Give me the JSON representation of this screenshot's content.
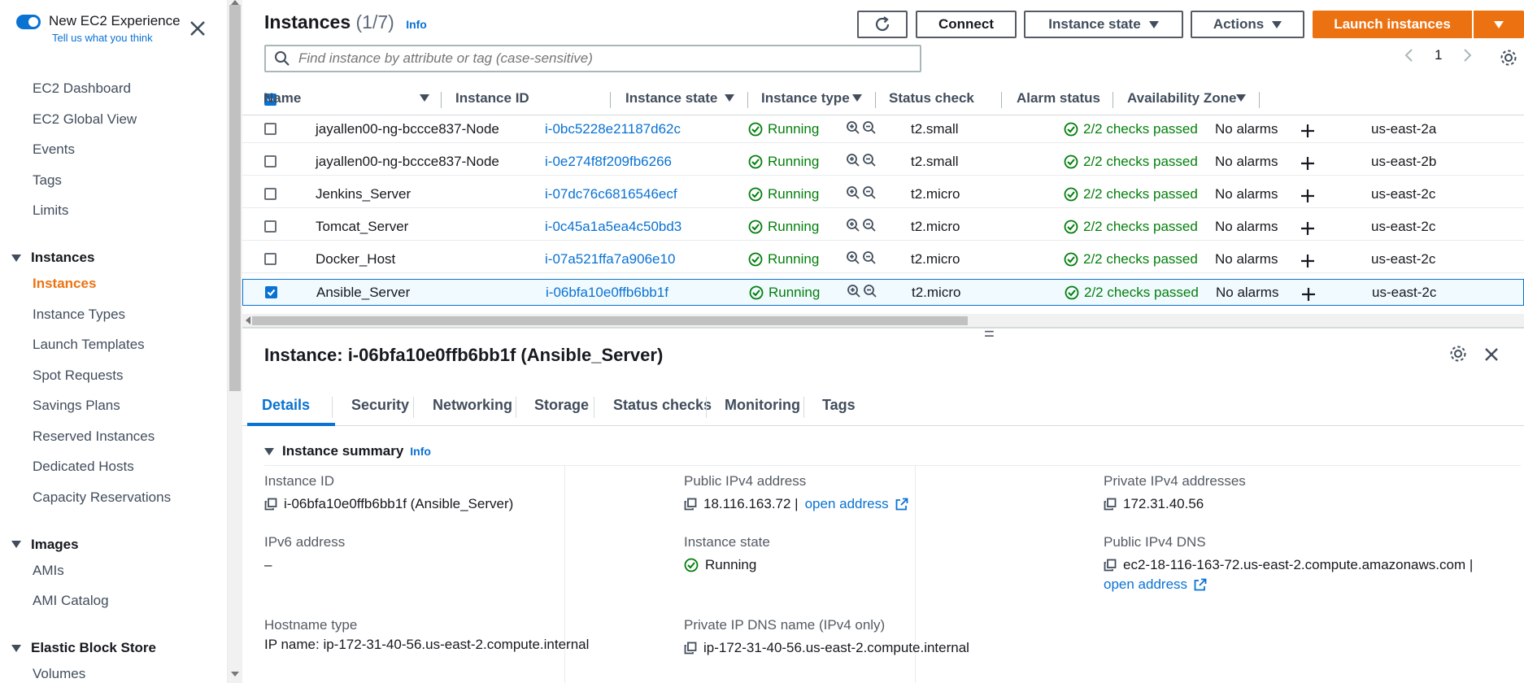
{
  "sidebar": {
    "toggle_title": "New EC2 Experience",
    "toggle_sub": "Tell us what you think",
    "top_items": [
      "EC2 Dashboard",
      "EC2 Global View",
      "Events",
      "Tags",
      "Limits"
    ],
    "instances_section": "Instances",
    "instances_items": [
      "Instances",
      "Instance Types",
      "Launch Templates",
      "Spot Requests",
      "Savings Plans",
      "Reserved Instances",
      "Dedicated Hosts",
      "Capacity Reservations"
    ],
    "images_section": "Images",
    "images_items": [
      "AMIs",
      "AMI Catalog"
    ],
    "ebs_section": "Elastic Block Store",
    "ebs_items": [
      "Volumes"
    ]
  },
  "header": {
    "title": "Instances",
    "count": "(1/7)",
    "info": "Info",
    "connect": "Connect",
    "instance_state": "Instance state",
    "actions": "Actions",
    "launch": "Launch instances"
  },
  "search": {
    "placeholder": "Find instance by attribute or tag (case-sensitive)"
  },
  "pager": {
    "page": "1"
  },
  "table": {
    "columns": [
      "Name",
      "Instance ID",
      "Instance state",
      "Instance type",
      "Status check",
      "Alarm status",
      "Availability Zone"
    ],
    "rows": [
      {
        "name": "jayallen00-ng-bccce837-Node",
        "id": "i-0bc5228e21187d62c",
        "state": "Running",
        "type": "t2.small",
        "check": "2/2 checks passed",
        "alarm": "No alarms",
        "az": "us-east-2a"
      },
      {
        "name": "jayallen00-ng-bccce837-Node",
        "id": "i-0e274f8f209fb6266",
        "state": "Running",
        "type": "t2.small",
        "check": "2/2 checks passed",
        "alarm": "No alarms",
        "az": "us-east-2b"
      },
      {
        "name": "Jenkins_Server",
        "id": "i-07dc76c6816546ecf",
        "state": "Running",
        "type": "t2.micro",
        "check": "2/2 checks passed",
        "alarm": "No alarms",
        "az": "us-east-2c"
      },
      {
        "name": "Tomcat_Server",
        "id": "i-0c45a1a5ea4c50bd3",
        "state": "Running",
        "type": "t2.micro",
        "check": "2/2 checks passed",
        "alarm": "No alarms",
        "az": "us-east-2c"
      },
      {
        "name": "Docker_Host",
        "id": "i-07a521ffa7a906e10",
        "state": "Running",
        "type": "t2.micro",
        "check": "2/2 checks passed",
        "alarm": "No alarms",
        "az": "us-east-2c"
      },
      {
        "name": "Ansible_Server",
        "id": "i-06bfa10e0ffb6bb1f",
        "state": "Running",
        "type": "t2.micro",
        "check": "2/2 checks passed",
        "alarm": "No alarms",
        "az": "us-east-2c"
      }
    ]
  },
  "detail": {
    "title": "Instance: i-06bfa10e0ffb6bb1f (Ansible_Server)",
    "tabs": [
      "Details",
      "Security",
      "Networking",
      "Storage",
      "Status checks",
      "Monitoring",
      "Tags"
    ],
    "summary_title": "Instance summary",
    "summary_info": "Info",
    "instance_id_label": "Instance ID",
    "instance_id_value": "i-06bfa10e0ffb6bb1f (Ansible_Server)",
    "public_ipv4_label": "Public IPv4 address",
    "public_ipv4_value": "18.116.163.72 |",
    "open_address": "open address",
    "private_ipv4_label": "Private IPv4 addresses",
    "private_ipv4_value": "172.31.40.56",
    "ipv6_label": "IPv6 address",
    "ipv6_value": "–",
    "instance_state_label": "Instance state",
    "instance_state_value": "Running",
    "public_dns_label": "Public IPv4 DNS",
    "public_dns_value": "ec2-18-116-163-72.us-east-2.compute.amazonaws.com |",
    "hostname_type_label": "Hostname type",
    "hostname_type_value": "IP name: ip-172-31-40-56.us-east-2.compute.internal",
    "private_dns_label": "Private IP DNS name (IPv4 only)",
    "private_dns_value": "ip-172-31-40-56.us-east-2.compute.internal"
  },
  "colors": {
    "accent": "#0972d3",
    "orange": "#ec7211",
    "green": "#037f0c"
  }
}
